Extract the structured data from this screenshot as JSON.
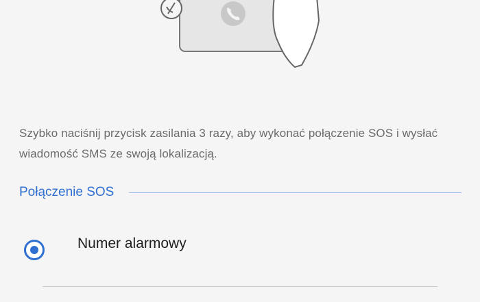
{
  "description": "Szybko naciśnij przycisk zasilania 3 razy, aby wykonać połączenie SOS i wysłać wiadomość SMS ze swoją lokalizacją.",
  "section": {
    "title": "Połączenie SOS"
  },
  "options": [
    {
      "label": "Numer alarmowy",
      "selected": true
    }
  ],
  "colors": {
    "accent": "#2f6fd1",
    "background": "#f5f5f5",
    "text_secondary": "#6b6b6b"
  },
  "icons": {
    "illustration": "phone-in-hand-illustration",
    "call": "phone-call-icon"
  }
}
